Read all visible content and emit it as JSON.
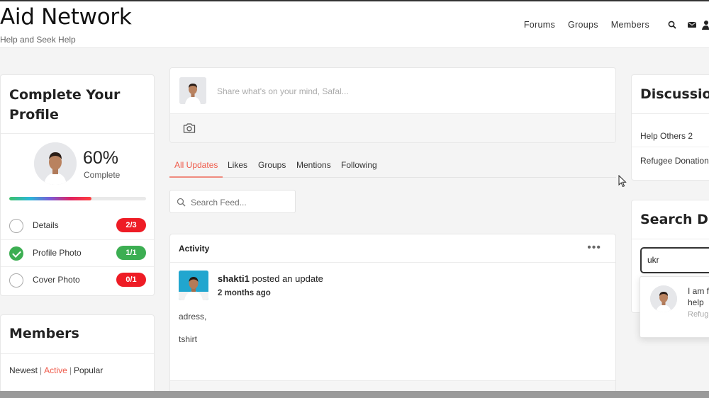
{
  "site": {
    "title": "Aid Network",
    "tagline": "Help and Seek Help"
  },
  "nav": {
    "links": [
      "Forums",
      "Groups",
      "Members"
    ],
    "icons": [
      "search-icon",
      "mail-icon",
      "user-icon"
    ]
  },
  "complete_profile": {
    "title": "Complete Your Profile",
    "percent": "60%",
    "percent_value": 0.6,
    "complete_label": "Complete",
    "items": [
      {
        "label": "Details",
        "badge": "2/3",
        "done": false,
        "badge_color": "#ee1c25"
      },
      {
        "label": "Profile Photo",
        "badge": "1/1",
        "done": true,
        "badge_color": "#3cae52"
      },
      {
        "label": "Cover Photo",
        "badge": "0/1",
        "done": false,
        "badge_color": "#ee1c25"
      }
    ]
  },
  "members": {
    "title": "Members",
    "filters": [
      "Newest",
      "Active",
      "Popular"
    ],
    "active_filter": "Active",
    "separator": "|"
  },
  "post_box": {
    "placeholder": "Share what's on your mind, Safal..."
  },
  "tabs": [
    "All Updates",
    "Likes",
    "Groups",
    "Mentions",
    "Following"
  ],
  "active_tab": "All Updates",
  "search_feed": {
    "placeholder": "Search Feed..."
  },
  "activity": {
    "title": "Activity",
    "more": "•••",
    "user": "shakti1",
    "action": "posted an update",
    "time": "2 months ago",
    "lines": [
      "adress,",
      "tshirt"
    ]
  },
  "discussions": {
    "title": "Discussion",
    "items": [
      "Help Others 2",
      "Refugee Donation"
    ]
  },
  "search_discussions": {
    "title": "Search Dis",
    "value": "ukr",
    "result_text": "I am f help",
    "result_line1": "I am f",
    "result_line2": "help",
    "result_sub": "Refug"
  },
  "colors": {
    "accent": "#ef5a4a",
    "success": "#3cae52",
    "danger": "#ee1c25"
  }
}
